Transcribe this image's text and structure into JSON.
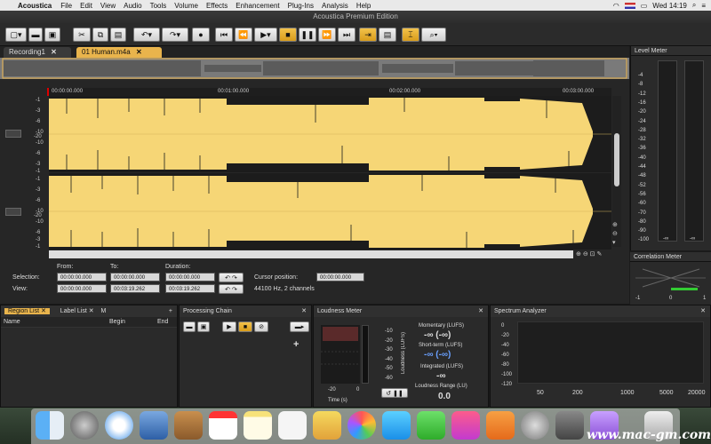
{
  "menubar": {
    "app_name": "Acoustica",
    "items": [
      "File",
      "Edit",
      "View",
      "Audio",
      "Tools",
      "Volume",
      "Effects",
      "Enhancement",
      "Plug-Ins",
      "Analysis",
      "Help"
    ],
    "clock": "Wed 14:19"
  },
  "window": {
    "title": "Acoustica Premium Edition"
  },
  "tabs": [
    {
      "label": "Recording1"
    },
    {
      "label": "01 Human.m4a"
    }
  ],
  "ruler": {
    "ticks": [
      "00:00:00.000",
      "00:01:00.000",
      "00:02:00.000",
      "00:03:00.000"
    ]
  },
  "levels": [
    "-1",
    "-3",
    "-6",
    "-10",
    "-20",
    "-10",
    "-6",
    "-3",
    "-1"
  ],
  "levels2": [
    "-1",
    "-3",
    "-6",
    "-10",
    "-20",
    "-10",
    "-6",
    "-3",
    "-1"
  ],
  "info": {
    "from_label": "From:",
    "to_label": "To:",
    "duration_label": "Duration:",
    "selection_label": "Selection:",
    "view_label": "View:",
    "sel_from": "00:00:00.000",
    "sel_to": "00:00:00.000",
    "sel_duration": "00:00:00.000",
    "view_from": "00:00:00.000",
    "view_to": "00:03:19.262",
    "view_duration": "00:03:19.262",
    "cursor_label": "Cursor position:",
    "cursor_value": "00:00:00.000",
    "format": "44100 Hz, 2 channels"
  },
  "level_meter": {
    "title": "Level Meter",
    "scale": [
      "-4",
      "-8",
      "-12",
      "-16",
      "-20",
      "-24",
      "-28",
      "-32",
      "-36",
      "-40",
      "-44",
      "-48",
      "-52",
      "-56",
      "-60",
      "-70",
      "-80",
      "-90",
      "-100"
    ],
    "left_readout": "-∞",
    "right_readout": "-∞"
  },
  "correlation_meter": {
    "title": "Correlation Meter",
    "min": "-1",
    "mid": "0",
    "max": "1"
  },
  "region_list": {
    "title": "Region List",
    "tab2": "Label List",
    "tab3": "M",
    "columns": [
      "Name",
      "Begin",
      "End"
    ]
  },
  "processing_chain": {
    "title": "Processing Chain"
  },
  "loudness_meter": {
    "title": "Loudness Meter",
    "scale": [
      "-10",
      "-20",
      "-30",
      "-40",
      "-50",
      "-60"
    ],
    "axis_label": "Loudness (LUFS)",
    "time_min": "-20",
    "time_max": "0",
    "time_label": "Time (s)",
    "momentary_label": "Momentary (LUFS)",
    "momentary_value": "-∞ (-∞)",
    "shortterm_label": "Short-term (LUFS)",
    "shortterm_value": "-∞ (-∞)",
    "integrated_label": "Integrated (LUFS)",
    "integrated_value": "-∞",
    "range_label": "Loudness Range (LU)",
    "range_value": "0.0"
  },
  "spectrum_analyzer": {
    "title": "Spectrum Analyzer",
    "yticks": [
      "0",
      "-20",
      "-40",
      "-60",
      "-80",
      "-100",
      "-120"
    ],
    "xticks": [
      "50",
      "200",
      "1000",
      "5000",
      "20000"
    ]
  },
  "watermark": "www.mac-gm.com",
  "colors": {
    "wave": "#f6d676",
    "accent": "#e9b44c",
    "panel": "#2a2a2a"
  }
}
